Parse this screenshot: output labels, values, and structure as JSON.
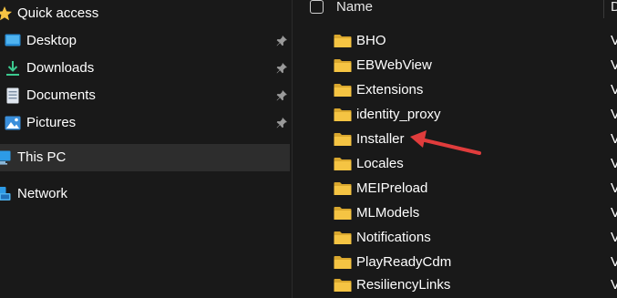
{
  "navigation": {
    "items": [
      {
        "label": "Quick access",
        "icon": "star-icon"
      },
      {
        "label": "Desktop",
        "icon": "desktop-icon",
        "pinned": true
      },
      {
        "label": "Downloads",
        "icon": "download-icon",
        "pinned": true
      },
      {
        "label": "Documents",
        "icon": "document-icon",
        "pinned": true
      },
      {
        "label": "Pictures",
        "icon": "pictures-icon",
        "pinned": true
      },
      {
        "label": "This PC",
        "icon": "computer-icon",
        "selected": true
      },
      {
        "label": "Network",
        "icon": "network-icon"
      }
    ]
  },
  "content": {
    "columns": {
      "name": "Name",
      "date_partial": "D"
    },
    "rows": [
      {
        "name": "BHO",
        "date_partial": "V"
      },
      {
        "name": "EBWebView",
        "date_partial": "V"
      },
      {
        "name": "Extensions",
        "date_partial": "V"
      },
      {
        "name": "identity_proxy",
        "date_partial": "V"
      },
      {
        "name": "Installer",
        "date_partial": "V",
        "highlighted_by_arrow": true
      },
      {
        "name": "Locales",
        "date_partial": "V"
      },
      {
        "name": "MEIPreload",
        "date_partial": "V"
      },
      {
        "name": "MLModels",
        "date_partial": "V"
      },
      {
        "name": "Notifications",
        "date_partial": "V"
      },
      {
        "name": "PlayReadyCdm",
        "date_partial": "V"
      },
      {
        "name": "ResiliencyLinks",
        "date_partial": "V"
      }
    ]
  },
  "colors": {
    "background": "#191919",
    "selected_nav": "#2d2d2d",
    "folder_yellow": "#f5c443",
    "annotation_arrow": "#e03c3c"
  }
}
